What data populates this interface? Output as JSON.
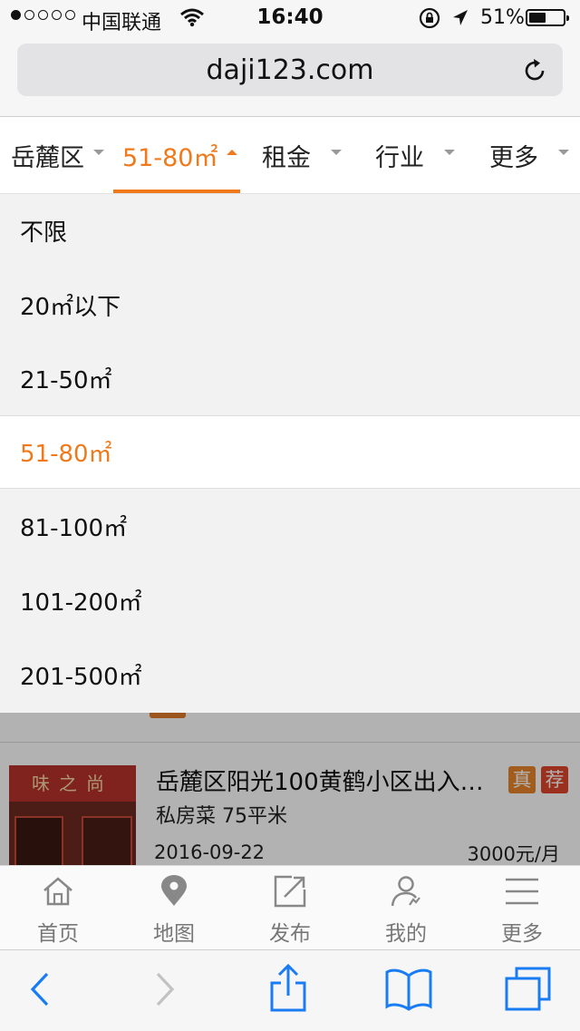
{
  "status_bar": {
    "carrier": "中国联通",
    "time": "16:40",
    "battery_percent": "51%",
    "battery_level": 0.51,
    "signal_dots_filled": 1,
    "signal_dots_total": 5
  },
  "browser": {
    "url": "daji123.com",
    "reload_icon": "reload-icon"
  },
  "filter_tabs": [
    {
      "label": "岳麓区",
      "active": false
    },
    {
      "label": "51-80㎡",
      "active": true
    },
    {
      "label": "租金",
      "active": false
    },
    {
      "label": "行业",
      "active": false
    },
    {
      "label": "更多",
      "active": false
    }
  ],
  "area_options": [
    {
      "label": "不限",
      "selected": false
    },
    {
      "label": "20㎡以下",
      "selected": false
    },
    {
      "label": "21-50㎡",
      "selected": false
    },
    {
      "label": "51-80㎡",
      "selected": true
    },
    {
      "label": "81-100㎡",
      "selected": false
    },
    {
      "label": "101-200㎡",
      "selected": false
    },
    {
      "label": "201-500㎡",
      "selected": false
    }
  ],
  "listing": {
    "title": "岳麓区阳光100黄鹤小区出入…",
    "badge_real": "真",
    "badge_recommended": "荐",
    "subtitle": "私房菜 75平米",
    "date": "2016-09-22",
    "price": "3000元/月",
    "thumbnail_sign": "味之尚"
  },
  "site_nav": [
    {
      "label": "首页",
      "icon": "home-icon"
    },
    {
      "label": "地图",
      "icon": "map-pin-icon"
    },
    {
      "label": "发布",
      "icon": "publish-icon"
    },
    {
      "label": "我的",
      "icon": "user-icon"
    },
    {
      "label": "更多",
      "icon": "menu-icon"
    }
  ],
  "safari_toolbar": {
    "icons": [
      "back-icon",
      "forward-icon",
      "share-icon",
      "bookmarks-icon",
      "tabs-icon"
    ]
  },
  "colors": {
    "accent": "#f07a1b",
    "badge_real": "#e9842a",
    "badge_recommended": "#e0462c",
    "ios_blue": "#1a7cf3"
  }
}
